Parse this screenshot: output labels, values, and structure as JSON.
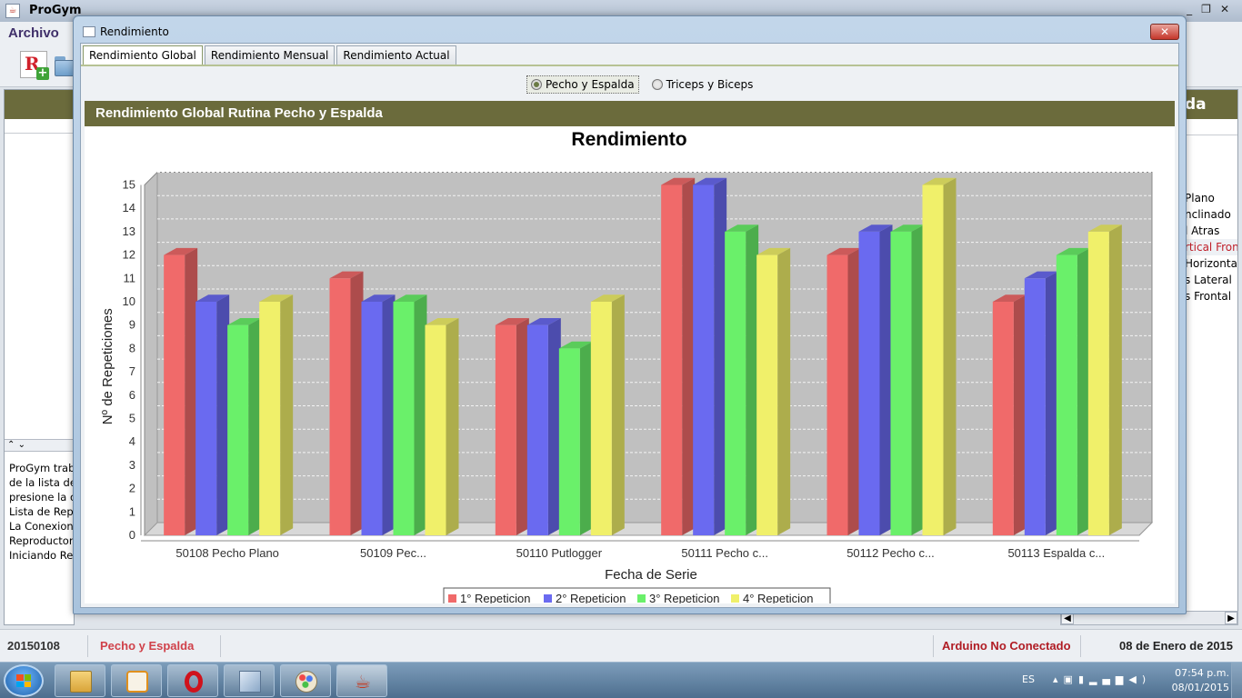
{
  "app": {
    "title": "ProGym",
    "menu": {
      "archivo": "Archivo"
    },
    "toolbar": {
      "r_button": "R"
    },
    "left_panel": {
      "log_lines": [
        "ProGym trab",
        "de la lista de",
        "presione la op",
        "Lista de Repr",
        "La Conexion",
        "Reproductor",
        "Iniciando Rep"
      ]
    },
    "right_panel": {
      "header": "da",
      "items": [
        "Plano",
        "nclinado",
        "l Atras",
        "rtical Front",
        "Horizontal",
        "s Lateral",
        "s Frontal"
      ],
      "selected_index": 3
    },
    "status": {
      "date_code": "20150108",
      "routine": "Pecho y Espalda",
      "arduino": "Arduino No Conectado",
      "date_long": "08 de Enero de 2015"
    },
    "taskbar": {
      "lang": "ES",
      "time": "07:54 p.m.",
      "date": "08/01/2015"
    }
  },
  "dialog": {
    "title": "Rendimiento",
    "close": "✕",
    "tabs": [
      "Rendimiento Global",
      "Rendimiento Mensual",
      "Rendimiento Actual"
    ],
    "active_tab": 0,
    "radios": [
      "Pecho y Espalda",
      "Triceps y Biceps"
    ],
    "selected_radio": 0,
    "section_header": "Rendimiento Global Rutina Pecho y Espalda"
  },
  "colors": {
    "series": [
      "#f06a6a",
      "#6a6af0",
      "#6af06a",
      "#f0f06a"
    ],
    "header_bg": "#6b6b3c",
    "plot_bg": "#c0c0c0"
  },
  "chart_data": {
    "type": "bar",
    "title": "Rendimiento",
    "xlabel": "Fecha de Serie",
    "ylabel": "Nº de Repeticiones",
    "ylim": [
      0,
      15
    ],
    "yticks": [
      0,
      1,
      2,
      3,
      4,
      5,
      6,
      7,
      8,
      9,
      10,
      11,
      12,
      13,
      14,
      15
    ],
    "categories": [
      "50108 Pecho Plano",
      "50109 Pec...",
      "50110 Putlogger",
      "50111 Pecho c...",
      "50112 Pecho c...",
      "50113 Espalda c..."
    ],
    "series": [
      {
        "name": "1° Repeticion",
        "values": [
          12,
          11,
          9,
          15,
          12,
          10
        ]
      },
      {
        "name": "2° Repeticion",
        "values": [
          10,
          10,
          9,
          15,
          13,
          11
        ]
      },
      {
        "name": "3° Repeticion",
        "values": [
          9,
          10,
          8,
          13,
          13,
          12
        ]
      },
      {
        "name": "4° Repeticion",
        "values": [
          10,
          9,
          10,
          12,
          15,
          13
        ]
      }
    ],
    "grid": true,
    "legend": "bottom"
  }
}
